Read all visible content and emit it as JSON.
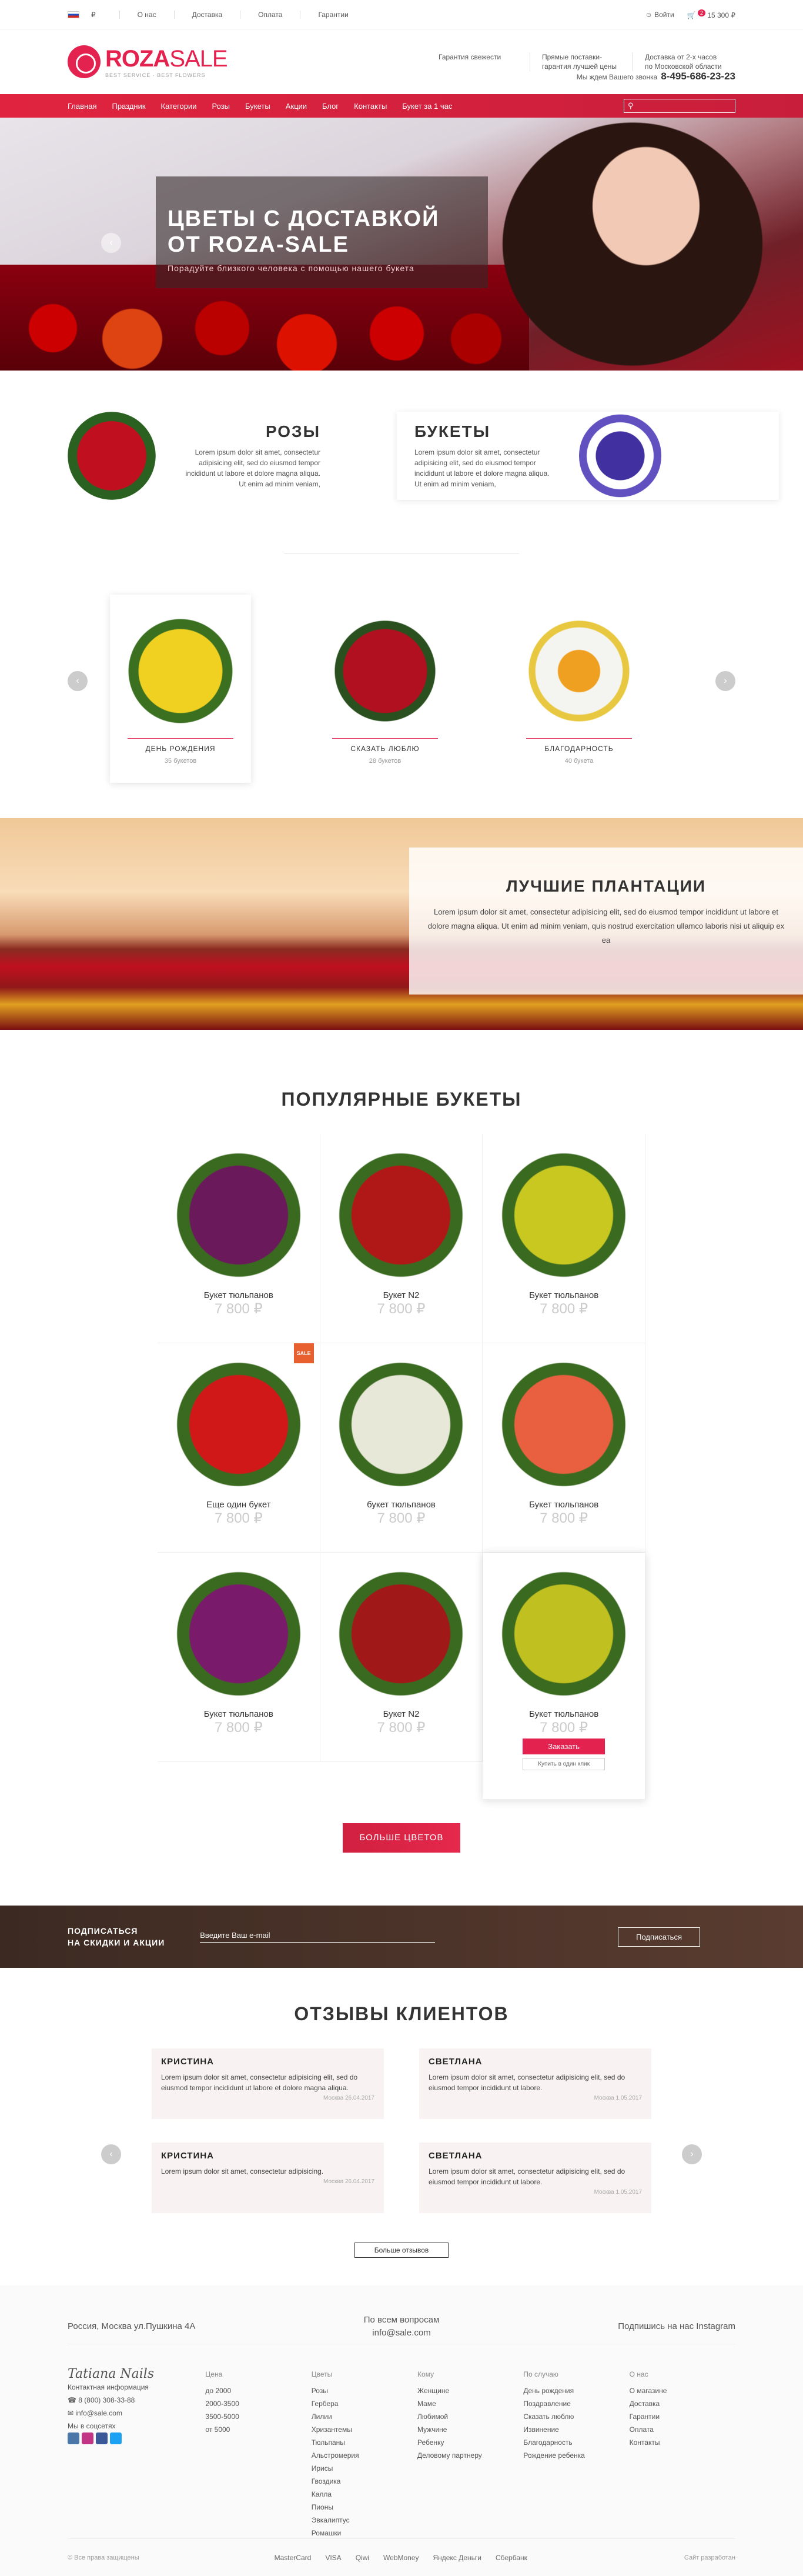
{
  "topbar": {
    "currency": "₽",
    "nav": [
      "О нас",
      "Доставка",
      "Оплата",
      "Гарантии"
    ],
    "login": "Войти",
    "cart_count": "2",
    "cart_total": "15 300 ₽"
  },
  "header": {
    "logo_main": "ROZA",
    "logo_sub_word": "SALE",
    "logo_tagline": "BEST SERVICE · BEST FLOWERS",
    "info": [
      "Гарантия свежести",
      "Прямые поставки-гарантия лучшей цены",
      "Доставка от 2-х часов по Московской области"
    ],
    "phone_label": "Мы ждем Вашего звонка",
    "phone": "8-495-686-23-23"
  },
  "nav": {
    "items": [
      "Главная",
      "Праздник",
      "Категории",
      "Розы",
      "Букеты",
      "Акции",
      "Блог",
      "Контакты",
      "Букет за 1 час"
    ],
    "search_placeholder": ""
  },
  "hero": {
    "title1": "ЦВЕТЫ С ДОСТАВКОЙ",
    "title2": "ОТ ROZA-SALE",
    "subtitle": "Порадуйте близкого человека с помощью нашего букета"
  },
  "categories": [
    {
      "title": "РОЗЫ",
      "text": "Lorem ipsum dolor sit amet, consectetur adipisicing elit, sed do eiusmod tempor incididunt ut labore et dolore magna aliqua. Ut enim ad minim veniam,"
    },
    {
      "title": "БУКЕТЫ",
      "text": "Lorem ipsum dolor sit amet, consectetur adipisicing elit, sed do eiusmod tempor incididunt ut labore et dolore magna aliqua. Ut enim ad minim veniam,"
    }
  ],
  "occasions": [
    {
      "label": "ДЕНЬ РОЖДЕНИЯ",
      "count": "35 букетов"
    },
    {
      "label": "СКАЗАТЬ ЛЮБЛЮ",
      "count": "28 букетов"
    },
    {
      "label": "БЛАГОДАРНОСТЬ",
      "count": "40 букета"
    }
  ],
  "plantation": {
    "title": "ЛУЧШИЕ ПЛАНТАЦИИ",
    "text": "Lorem ipsum dolor sit amet, consectetur adipisicing elit, sed do eiusmod tempor incididunt ut labore et dolore magna aliqua. Ut enim ad minim veniam, quis nostrud exercitation ullamco laboris nisi ut aliquip ex ea"
  },
  "popular": {
    "title": "ПОПУЛЯРНЫЕ БУКЕТЫ",
    "items": [
      {
        "name": "Букет тюльпанов",
        "price": "7 800 ₽",
        "badge": "",
        "color": "#6a1a5a"
      },
      {
        "name": "Букет N2",
        "price": "7 800 ₽",
        "badge": "",
        "color": "#b01818"
      },
      {
        "name": "Букет тюльпанов",
        "price": "7 800 ₽",
        "badge": "",
        "color": "#c8c820"
      },
      {
        "name": "Еще один букет",
        "price": "7 800 ₽",
        "badge": "SALE",
        "color": "#d01818"
      },
      {
        "name": "букет тюльпанов",
        "price": "7 800 ₽",
        "badge": "",
        "color": "#e8e8d8"
      },
      {
        "name": "Букет тюльпанов",
        "price": "7 800 ₽",
        "badge": "",
        "color": "#e86040"
      },
      {
        "name": "Букет тюльпанов",
        "price": "7 800 ₽",
        "badge": "",
        "color": "#7a1a6a"
      },
      {
        "name": "Букет N2",
        "price": "7 800 ₽",
        "badge": "",
        "color": "#a01818"
      },
      {
        "name": "Букет тюльпанов",
        "price": "7 800 ₽",
        "badge": "",
        "color": "#c0c020"
      }
    ],
    "order": "Заказать",
    "one_click": "Купить в один клик",
    "more": "БОЛЬШЕ ЦВЕТОВ"
  },
  "subscribe": {
    "title1": "ПОДПИСАТЬСЯ",
    "title2": "НА СКИДКИ И АКЦИИ",
    "placeholder": "Введите Ваш e-mail",
    "button": "Подписаться"
  },
  "reviews": {
    "title": "ОТЗЫВЫ КЛИЕНТОВ",
    "items": [
      {
        "name": "КРИСТИНА",
        "text": "Lorem ipsum dolor sit amet, consectetur adipisicing elit, sed do eiusmod tempor incididunt ut labore et dolore magna aliqua.",
        "date": "Москва 26.04.2017"
      },
      {
        "name": "СВЕТЛАНА",
        "text": "Lorem ipsum dolor sit amet, consectetur adipisicing elit, sed do eiusmod tempor incididunt ut labore.",
        "date": "Москва 1.05.2017"
      },
      {
        "name": "КРИСТИНА",
        "text": "Lorem ipsum dolor sit amet, consectetur adipisicing.",
        "date": "Москва 26.04.2017"
      },
      {
        "name": "СВЕТЛАНА",
        "text": "Lorem ipsum dolor sit amet, consectetur adipisicing elit, sed do eiusmod tempor incididunt ut labore.",
        "date": "Москва 1.05.2017"
      }
    ],
    "all": "Больше отзывов"
  },
  "footer": {
    "address": "Россия, Москва ул.Пушкина 4А",
    "questions": "По всем вопросам",
    "email_top": "info@sale.com",
    "instagram": "Подпишись на нас Instagram",
    "brand": "Tatiana Nails",
    "contact_title": "Контактная информация",
    "phone": "8 (800) 308-33-88",
    "email": "info@sale.com",
    "social": "Мы в соцсетях",
    "cols": [
      {
        "h": "Цена",
        "items": [
          "до 2000",
          "2000-3500",
          "3500-5000",
          "от 5000"
        ]
      },
      {
        "h": "Цветы",
        "items": [
          "Розы",
          "Гербера",
          "Лилии",
          "Хризантемы",
          "Тюльпаны",
          "Альстромерия",
          "Ирисы",
          "Гвоздика",
          "Калла",
          "Пионы",
          "Эвкалиптус",
          "Ромашки"
        ]
      },
      {
        "h": "Кому",
        "items": [
          "Женщине",
          "Маме",
          "Любимой",
          "Мужчине",
          "Ребенку",
          "Деловому партнеру"
        ]
      },
      {
        "h": "По случаю",
        "items": [
          "День рождения",
          "Поздравление",
          "Сказать люблю",
          "Извинение",
          "Благодарность",
          "Рождение ребенка"
        ]
      },
      {
        "h": "О нас",
        "items": [
          "О магазине",
          "Доставка",
          "Гарантии",
          "Оплата",
          "Контакты"
        ]
      }
    ],
    "copyright": "© Все права защищены",
    "pay": [
      "MasterCard",
      "VISA",
      "Qiwi",
      "WebMoney",
      "Яндекс Деньги",
      "Сбербанк"
    ],
    "dev": "Сайт разработан"
  }
}
